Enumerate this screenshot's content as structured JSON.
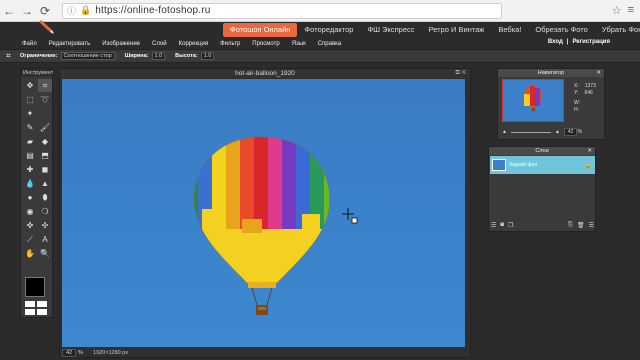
{
  "browser": {
    "url": "https://online-fotoshop.ru"
  },
  "top_nav": {
    "tabs": [
      {
        "label": "Фотошоп Онлайн",
        "active": true
      },
      {
        "label": "Фоторедактор"
      },
      {
        "label": "ФШ Экспресс"
      },
      {
        "label": "Ретро И Винтаж"
      },
      {
        "label": "Вебка!"
      },
      {
        "label": "Обрезать Фото"
      },
      {
        "label": "Убрать Фон"
      }
    ],
    "accent_color": "#e8683f"
  },
  "menu": {
    "items": [
      "Файл",
      "Редактировать",
      "Изображение",
      "Слой",
      "Коррекция",
      "Фильтр",
      "Просмотр",
      "Язык",
      "Справка"
    ],
    "login": "Вход",
    "separator": "|",
    "register": "Регистрация"
  },
  "options": {
    "constraint_label": "Ограничение:",
    "constraint_value": "Соотношение стор",
    "width_label": "Ширина:",
    "width_value": "1.0",
    "height_label": "Высота:",
    "height_value": "1.0"
  },
  "toolbox": {
    "title": "Инструмент"
  },
  "canvas": {
    "title": "hot-air-balloon_1920",
    "zoom": "42",
    "zoom_unit": "%",
    "size": "1920×1280 px"
  },
  "navigator": {
    "title": "Навигатор",
    "x_label": "X:",
    "x_value": "1373",
    "y_label": "Y:",
    "y_value": "646",
    "w_label": "W:",
    "h_label": "H:",
    "zoom": "42",
    "zoom_unit": "%"
  },
  "layers": {
    "title": "Слои",
    "layer_name": "Задний фон"
  }
}
